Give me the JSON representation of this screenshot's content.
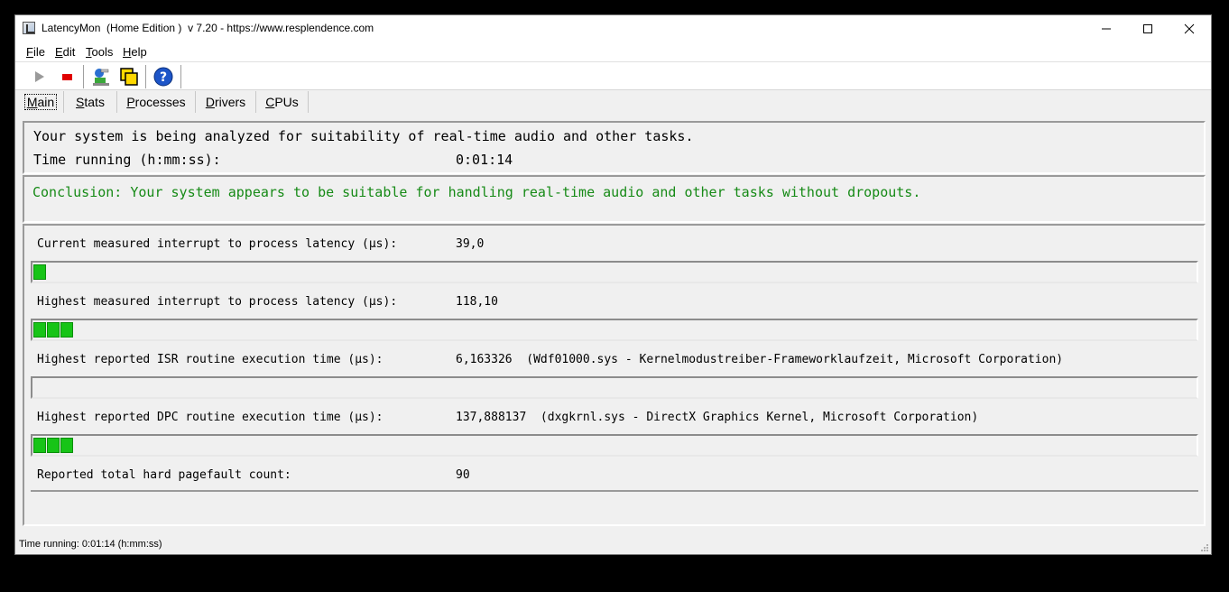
{
  "window": {
    "title": "LatencyMon  (Home Edition )  v 7.20 - https://www.resplendence.com"
  },
  "menu": [
    {
      "key": "F",
      "rest": "ile"
    },
    {
      "key": "E",
      "rest": "dit"
    },
    {
      "key": "T",
      "rest": "ools"
    },
    {
      "key": "H",
      "rest": "elp"
    }
  ],
  "toolbar": {
    "icons": [
      "play-icon",
      "stop-icon",
      "driver-icon",
      "windows-icon",
      "help-icon"
    ]
  },
  "tabs": [
    {
      "pre": "",
      "key": "M",
      "rest": "ain"
    },
    {
      "pre": "",
      "key": "S",
      "rest": "tats"
    },
    {
      "pre": "",
      "key": "P",
      "rest": "rocesses"
    },
    {
      "pre": "",
      "key": "D",
      "rest": "rivers"
    },
    {
      "pre": "",
      "key": "C",
      "rest": "PUs"
    }
  ],
  "status": {
    "analyzing": "Your system is being analyzed for suitability of real-time audio and other tasks.",
    "time_label": "Time running (h:mm:ss):",
    "time_value": "0:01:14"
  },
  "conclusion": "Conclusion: Your system appears to be suitable for handling real-time audio and other tasks without dropouts.",
  "metrics": [
    {
      "label": "Current measured interrupt to process latency (µs):",
      "value": "39,0",
      "segments": 1
    },
    {
      "label": "Highest measured interrupt to process latency (µs):",
      "value": "118,10",
      "segments": 3
    },
    {
      "label": "Highest reported ISR routine execution time (µs):",
      "value": "6,163326  (Wdf01000.sys - Kernelmodustreiber-Frameworklaufzeit, Microsoft Corporation)",
      "segments": 0
    },
    {
      "label": "Highest reported DPC routine execution time (µs):",
      "value": "137,888137  (dxgkrnl.sys - DirectX Graphics Kernel, Microsoft Corporation)",
      "segments": 3
    },
    {
      "label": "Reported total hard pagefault count:",
      "value": "90",
      "segments": 0
    }
  ],
  "statusbar": "Time running: 0:01:14  (h:mm:ss)",
  "colors": {
    "conclusion_green": "#168a16",
    "bar_green": "#17c417",
    "stop_red": "#e00000"
  }
}
